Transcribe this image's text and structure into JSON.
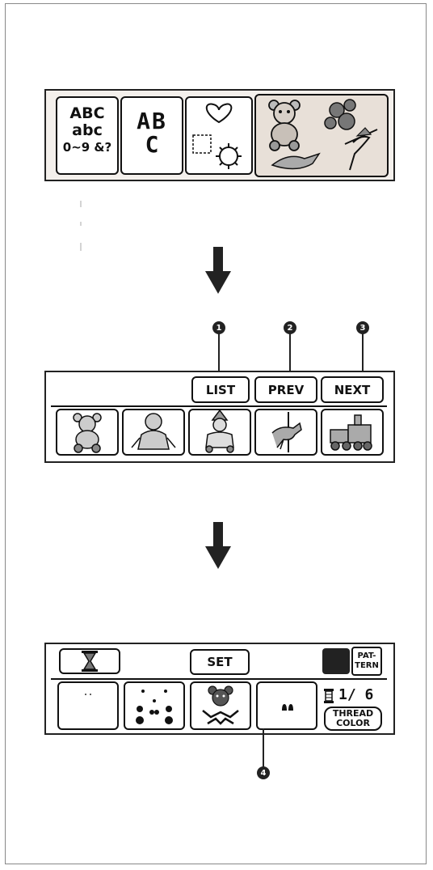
{
  "category_panel": {
    "charset_lines": [
      "ABC",
      "abc",
      "0~9 &?"
    ],
    "fancy_font_lines": [
      "AB",
      "C"
    ],
    "items": [
      "character-set",
      "decorative-font",
      "frame-shapes",
      "embroidery-patterns"
    ]
  },
  "pattern_panel": {
    "buttons": {
      "list": "LIST",
      "prev": "PREV",
      "next": "NEXT"
    },
    "callouts": [
      "1",
      "2",
      "3"
    ],
    "patterns": [
      "teddy-bear",
      "doll",
      "clown",
      "carousel-horse",
      "train"
    ]
  },
  "edit_panel": {
    "set_label": "SET",
    "pattern_label_1": "PAT-",
    "pattern_label_2": "TERN",
    "counter": "1/ 6",
    "thread_color_1": "THREAD",
    "thread_color_2": "COLOR",
    "callout": "4"
  },
  "colors": {
    "ink": "#111111",
    "panel_shade": "#e8e0d8",
    "callout": "#222222"
  }
}
